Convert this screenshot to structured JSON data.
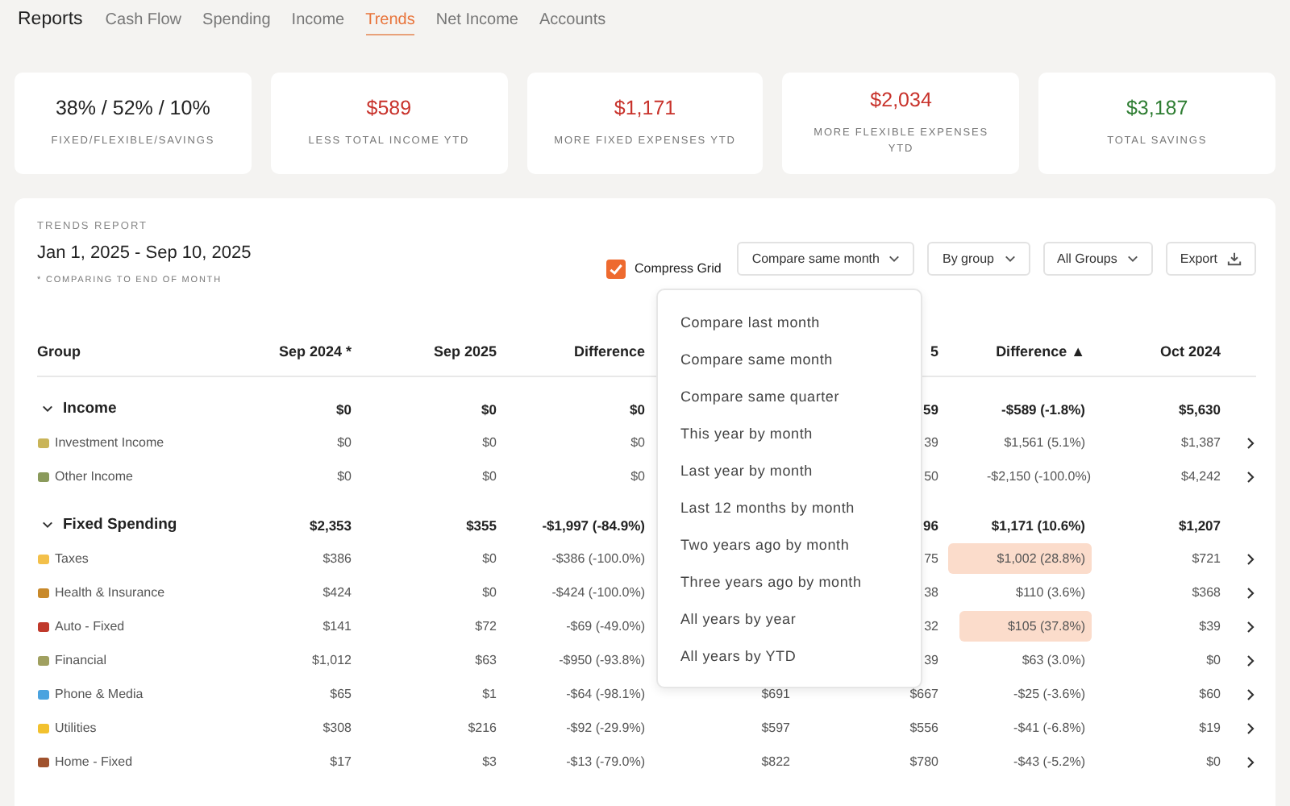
{
  "nav": {
    "title": "Reports",
    "tabs": [
      {
        "label": "Cash Flow",
        "selected": false
      },
      {
        "label": "Spending",
        "selected": false
      },
      {
        "label": "Income",
        "selected": false
      },
      {
        "label": "Trends",
        "selected": true
      },
      {
        "label": "Net Income",
        "selected": false
      },
      {
        "label": "Accounts",
        "selected": false
      }
    ]
  },
  "cards": [
    {
      "value": "38% / 52% / 10%",
      "label": "FIXED/FLEXIBLE/SAVINGS",
      "kind": "neutral"
    },
    {
      "value": "$589",
      "label": "LESS TOTAL INCOME YTD",
      "kind": "negative"
    },
    {
      "value": "$1,171",
      "label": "MORE FIXED EXPENSES YTD",
      "kind": "negative"
    },
    {
      "value": "$2,034",
      "label": "MORE FLEXIBLE EXPENSES YTD",
      "kind": "negative"
    },
    {
      "value": "$3,187",
      "label": "TOTAL SAVINGS",
      "kind": "positive"
    }
  ],
  "report": {
    "eyebrow": "TRENDS REPORT",
    "date_range": "Jan 1, 2025 - Sep 10, 2025",
    "note": "* COMPARING TO END OF MONTH",
    "compress_grid": {
      "label": "Compress Grid",
      "checked": true
    },
    "buttons": [
      {
        "label": "Compare same month",
        "kind": "dropdown"
      },
      {
        "label": "By group",
        "kind": "dropdown"
      },
      {
        "label": "All Groups",
        "kind": "dropdown"
      },
      {
        "label": "Export",
        "kind": "export"
      }
    ],
    "menu": [
      "Compare last month",
      "Compare same month",
      "Compare same quarter",
      "This year by month",
      "Last year by month",
      "Last 12 months by month",
      "Two years ago by month",
      "Three years ago by month",
      "All years by year",
      "All years by YTD"
    ],
    "table": {
      "columns": [
        "Group",
        "Sep 2024 *",
        "Sep 2025",
        "Difference",
        null,
        "5",
        "Difference ▲",
        "Oct 2024"
      ],
      "groups": [
        {
          "name": "Income",
          "expanded": true,
          "cells": [
            "$0",
            "$0",
            "$0",
            null,
            "59",
            "-$589 (-1.8%)",
            "$5,630"
          ],
          "rows": [
            {
              "name": "Investment Income",
              "cells": [
                "$0",
                "$0",
                "$0",
                null,
                "39",
                "$1,561 (5.1%)",
                "$1,387"
              ],
              "highlighted": false
            },
            {
              "name": "Other Income",
              "cells": [
                "$0",
                "$0",
                "$0",
                null,
                "50",
                "-$2,150 (-100.0%)",
                "$4,242"
              ],
              "highlighted": false
            }
          ]
        },
        {
          "name": "Fixed Spending",
          "expanded": true,
          "cells": [
            "$2,353",
            "$355",
            "-$1,997 (-84.9%)",
            null,
            "96",
            "$1,171 (10.6%)",
            "$1,207"
          ],
          "rows": [
            {
              "name": "Taxes",
              "cells": [
                "$386",
                "$0",
                "-$386 (-100.0%)",
                null,
                "75",
                "$1,002 (28.8%)",
                "$721"
              ],
              "highlighted": true
            },
            {
              "name": "Health & Insurance",
              "cells": [
                "$424",
                "$0",
                "-$424 (-100.0%)",
                null,
                "38",
                "$110 (3.6%)",
                "$368"
              ],
              "highlighted": false
            },
            {
              "name": "Auto - Fixed",
              "cells": [
                "$141",
                "$72",
                "-$69 (-49.0%)",
                null,
                "32",
                "$105 (37.8%)",
                "$39"
              ],
              "highlighted": true
            },
            {
              "name": "Financial",
              "cells": [
                "$1,012",
                "$63",
                "-$950 (-93.8%)",
                null,
                "39",
                "$63 (3.0%)",
                "$0"
              ],
              "highlighted": false
            },
            {
              "name": "Phone & Media",
              "cells": [
                "$65",
                "$1",
                "-$64 (-98.1%)",
                "$691",
                "$667",
                "-$25 (-3.6%)",
                "$60"
              ],
              "highlighted": false
            },
            {
              "name": "Utilities",
              "cells": [
                "$308",
                "$216",
                "-$92 (-29.9%)",
                "$597",
                "$556",
                "-$41 (-6.8%)",
                "$19"
              ],
              "highlighted": false
            },
            {
              "name": "Home - Fixed",
              "cells": [
                "$17",
                "$3",
                "-$13 (-79.0%)",
                "$822",
                "$780",
                "-$43 (-5.2%)",
                "$0"
              ],
              "highlighted": false
            }
          ]
        }
      ]
    }
  }
}
